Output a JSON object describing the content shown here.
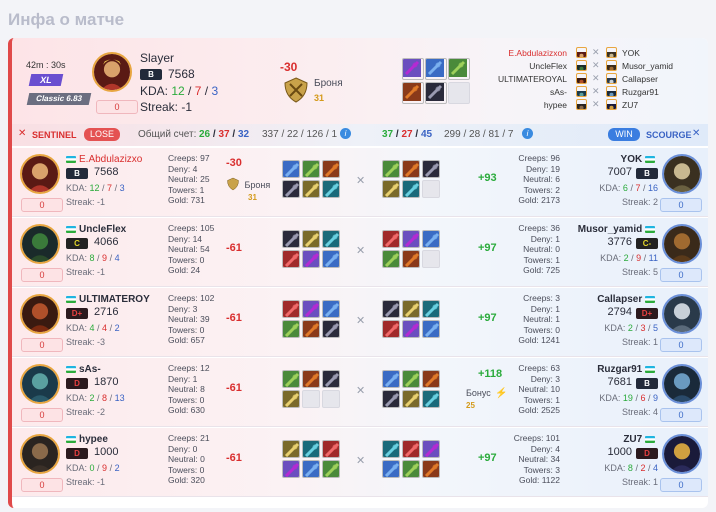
{
  "page_title": "Инфа о матче",
  "summary": {
    "duration_min": "42m",
    "duration_sec": "30s",
    "mode": "XL",
    "league": "Classic 6.83",
    "player": {
      "name": "Slayer",
      "rank": "B",
      "elo": "7568",
      "kda_label": "KDA:",
      "k": "12",
      "d": "7",
      "a": "3",
      "streak": "Streak: -1",
      "slot": "0"
    },
    "delta": "-30",
    "armor_label": "Броня",
    "armor_value": "31",
    "sentinel_names": [
      "E.Abdulazizxon",
      "UncleFlex",
      "ULTIMATEROYAL",
      "sAs-",
      "hypee"
    ],
    "scourge_names": [
      "YOK",
      "Musor_yamid",
      "Callapser",
      "Ruzgar91",
      "ZU7"
    ]
  },
  "teambar": {
    "sentinel": "SENTINEL",
    "lose": "LOSE",
    "score_label": "Общий счет:",
    "s_k": "26",
    "s_d": "37",
    "s_a": "32",
    "s_totals": "337 / 22 / 126 / 1",
    "c_k": "37",
    "c_d": "27",
    "c_a": "45",
    "c_totals": "299 / 28 / 81 / 7",
    "win": "WIN",
    "scourge": "SCOURGE"
  },
  "rows": [
    {
      "l": {
        "name": "E.Abdulazizxo",
        "rank": "B",
        "elo": "7568",
        "k": "12",
        "d": "7",
        "a": "3",
        "streak": "Streak: -1",
        "slot": "0",
        "creeps": "Creeps: 97",
        "deny": "Deny: 4",
        "neutral": "Neutral: 25",
        "towers": "Towers: 1",
        "gold": "Gold: 731",
        "delta": "-30",
        "armor": "Броня",
        "armor_val": "31"
      },
      "r": {
        "name": "YOK",
        "rank": "B",
        "elo": "7007",
        "k": "6",
        "d": "7",
        "a": "16",
        "streak": "Streak: 2",
        "slot": "0",
        "creeps": "Creeps: 96",
        "deny": "Deny: 19",
        "neutral": "Neutral: 6",
        "towers": "Towers: 2",
        "gold": "Gold: 2173",
        "delta": "+93"
      }
    },
    {
      "l": {
        "name": "UncleFlex",
        "rank": "C",
        "elo": "4066",
        "k": "8",
        "d": "9",
        "a": "4",
        "streak": "Streak: -1",
        "slot": "0",
        "creeps": "Creeps: 105",
        "deny": "Deny: 14",
        "neutral": "Neutral: 54",
        "towers": "Towers: 0",
        "gold": "Gold: 24",
        "delta": "-61"
      },
      "r": {
        "name": "Musor_yamid",
        "rank": "C-",
        "elo": "3776",
        "k": "2",
        "d": "9",
        "a": "11",
        "streak": "Streak: 5",
        "slot": "0",
        "creeps": "Creeps: 36",
        "deny": "Deny: 1",
        "neutral": "Neutral: 0",
        "towers": "Towers: 1",
        "gold": "Gold: 725",
        "delta": "+97"
      }
    },
    {
      "l": {
        "name": "ULTIMATEROY",
        "rank": "D+",
        "elo": "2716",
        "k": "4",
        "d": "4",
        "a": "2",
        "streak": "Streak: -3",
        "slot": "0",
        "creeps": "Creeps: 102",
        "deny": "Deny: 3",
        "neutral": "Neutral: 39",
        "towers": "Towers: 0",
        "gold": "Gold: 657",
        "delta": "-61"
      },
      "r": {
        "name": "Callapser",
        "rank": "D+",
        "elo": "2794",
        "k": "2",
        "d": "3",
        "a": "5",
        "streak": "Streak: 1",
        "slot": "0",
        "creeps": "Creeps: 3",
        "deny": "Deny: 1",
        "neutral": "Neutral: 1",
        "towers": "Towers: 0",
        "gold": "Gold: 1241",
        "delta": "+97"
      }
    },
    {
      "l": {
        "name": "sAs-",
        "rank": "D",
        "elo": "1870",
        "k": "2",
        "d": "8",
        "a": "13",
        "streak": "Streak: -2",
        "slot": "0",
        "creeps": "Creeps: 12",
        "deny": "Deny: 1",
        "neutral": "Neutral: 8",
        "towers": "Towers: 0",
        "gold": "Gold: 630",
        "delta": "-61"
      },
      "r": {
        "name": "Ruzgar91",
        "rank": "B",
        "elo": "7681",
        "k": "19",
        "d": "6",
        "a": "9",
        "streak": "Streak: 4",
        "slot": "0",
        "creeps": "Creeps: 63",
        "deny": "Deny: 3",
        "neutral": "Neutral: 10",
        "towers": "Towers: 1",
        "gold": "Gold: 2525",
        "delta": "+118",
        "bonus": "Бонус",
        "bonus_val": "25"
      }
    },
    {
      "l": {
        "name": "hypee",
        "rank": "D",
        "elo": "1000",
        "k": "0",
        "d": "9",
        "a": "2",
        "streak": "Streak: -1",
        "slot": "0",
        "creeps": "Creeps: 21",
        "deny": "Deny: 0",
        "neutral": "Neutral: 0",
        "towers": "Towers: 0",
        "gold": "Gold: 320",
        "delta": "-61"
      },
      "r": {
        "name": "ZU7",
        "rank": "D",
        "elo": "1000",
        "k": "8",
        "d": "2",
        "a": "4",
        "streak": "Streak: 1",
        "slot": "0",
        "creeps": "Creeps: 101",
        "deny": "Deny: 4",
        "neutral": "Neutral: 34",
        "towers": "Towers: 3",
        "gold": "Gold: 1122",
        "delta": "+97"
      }
    }
  ]
}
